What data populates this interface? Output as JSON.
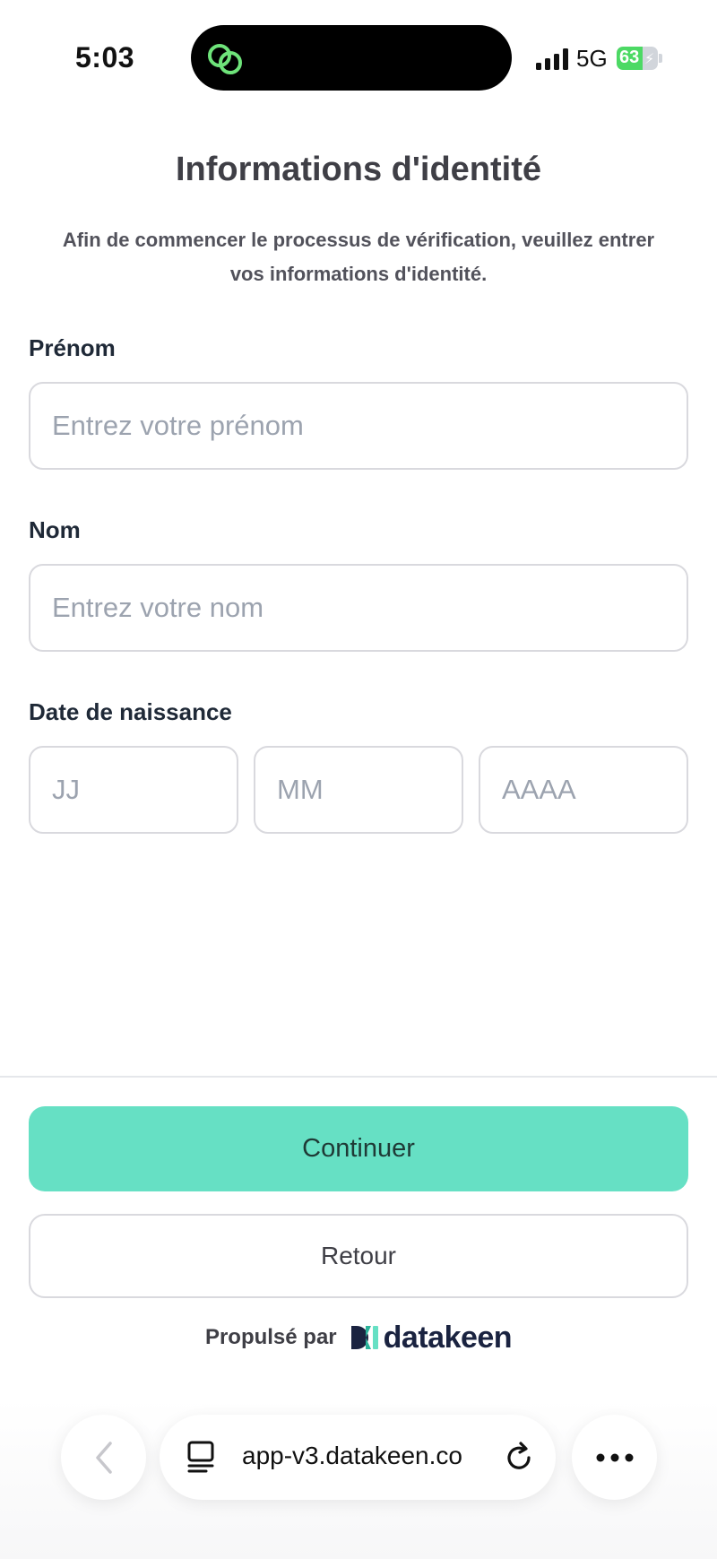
{
  "status_bar": {
    "time": "5:03",
    "network": "5G",
    "battery_percent": "63",
    "battery_level": 0.63,
    "battery_color": "#4cd964",
    "island_app_icon": "link-rings-icon"
  },
  "header": {
    "title": "Informations d'identité",
    "subtitle": "Afin de commencer le processus de vérification, veuillez entrer vos informations d'identité."
  },
  "form": {
    "first_name": {
      "label": "Prénom",
      "placeholder": "Entrez votre prénom",
      "value": ""
    },
    "last_name": {
      "label": "Nom",
      "placeholder": "Entrez votre nom",
      "value": ""
    },
    "birth_date": {
      "label": "Date de naissance",
      "day_placeholder": "JJ",
      "month_placeholder": "MM",
      "year_placeholder": "AAAA"
    }
  },
  "footer": {
    "continue_label": "Continuer",
    "back_label": "Retour",
    "powered_by": "Propulsé par",
    "brand_name": "datakeen",
    "accent_color": "#66e0c4"
  },
  "browser": {
    "url": "app-v3.datakeen.co",
    "icons": [
      "chevron-left-icon",
      "reader-mode-icon",
      "reload-icon",
      "more-icon"
    ]
  }
}
